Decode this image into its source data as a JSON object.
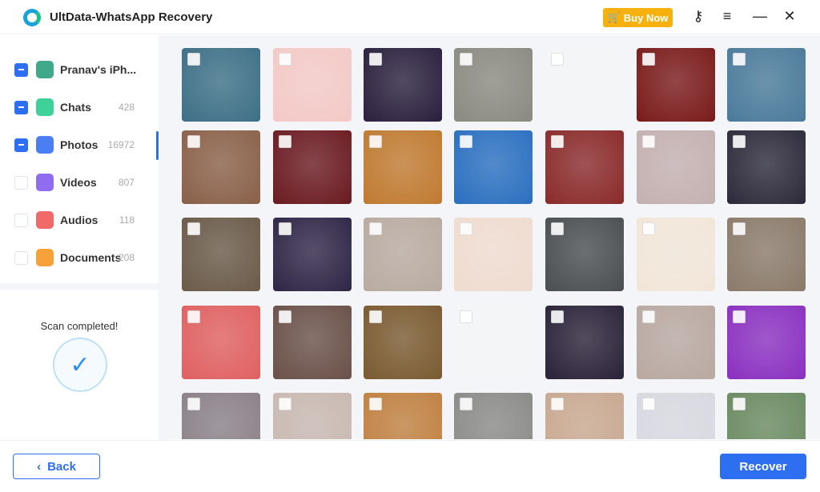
{
  "app": {
    "title": "UltData-WhatsApp Recovery",
    "buy_now": "Buy Now",
    "icons": [
      "key-icon",
      "menu-icon",
      "minimize-icon",
      "close-icon"
    ]
  },
  "sidebar": {
    "items": [
      {
        "label": "Pranav's iPh...",
        "count": "",
        "checked": true,
        "icon": "iphone-icon",
        "color": "#3fa98a"
      },
      {
        "label": "Chats",
        "count": "428",
        "checked": true,
        "icon": "chat-icon",
        "color": "#3ed19a"
      },
      {
        "label": "Photos",
        "count": "16972",
        "checked": true,
        "icon": "photos-icon",
        "color": "#4a7ef2",
        "active": true
      },
      {
        "label": "Videos",
        "count": "807",
        "checked": false,
        "icon": "video-icon",
        "color": "#8f6cf0"
      },
      {
        "label": "Audios",
        "count": "118",
        "checked": false,
        "icon": "audio-icon",
        "color": "#f06a6a"
      },
      {
        "label": "Documents",
        "count": "208",
        "checked": false,
        "icon": "folder-icon",
        "color": "#f7a13a"
      }
    ]
  },
  "scan": {
    "status": "Scan completed!"
  },
  "photos": [
    "#3d6f86",
    "#f4c9c6",
    "#2a1f3d",
    "#8a8a80",
    "#f4f5f7",
    "#7a1a1a",
    "#4a7a9a",
    "#8a6048",
    "#6a1a20",
    "#c07a30",
    "#2a6fc0",
    "#8a2a2a",
    "#c4b0b0",
    "#2c2a3a",
    "#6a5a48",
    "#2f2546",
    "#b8aaa0",
    "#f0dcd0",
    "#4a4e50",
    "#f2e6d8",
    "#8a7a6a",
    "#e06060",
    "#6a5048",
    "#7a5a30",
    "#f4f5f7",
    "#2a2238",
    "#b8a8a0",
    "#8a30c0",
    "#8a8088",
    "#c8b8b0",
    "#c08040",
    "#8a8a88",
    "#c8a890",
    "#d8d8e0",
    "#6a8a60"
  ],
  "footer": {
    "back": "Back",
    "recover": "Recover"
  },
  "colors": {
    "accent": "#2e6ef0",
    "buy": "#f6b10e"
  }
}
